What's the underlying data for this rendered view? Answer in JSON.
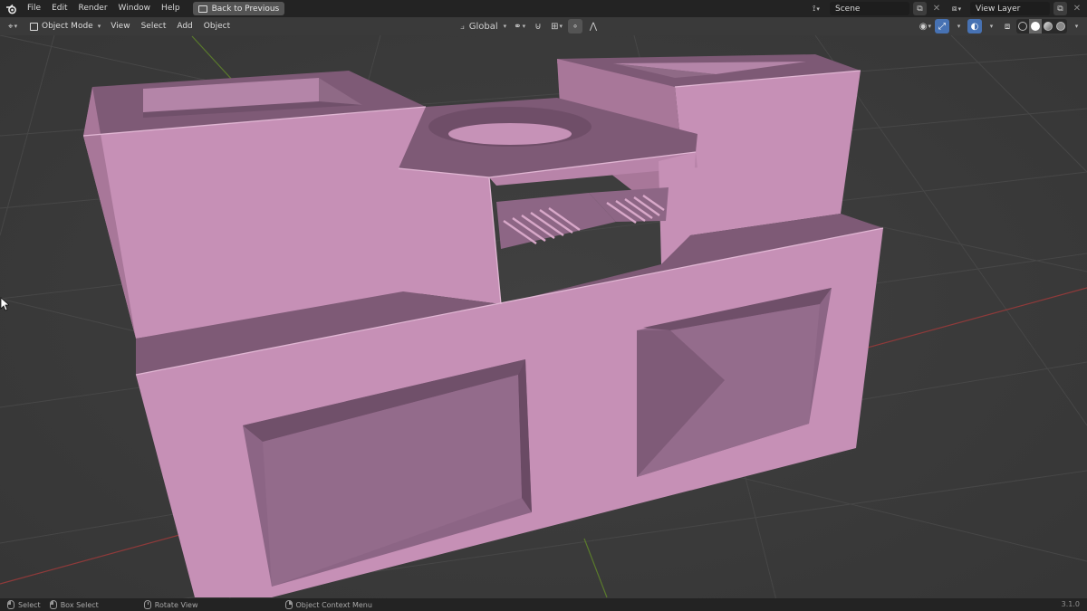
{
  "app": {
    "menu": [
      "File",
      "Edit",
      "Render",
      "Window",
      "Help"
    ],
    "back_button": "Back to Previous",
    "scene_name": "Scene",
    "view_layer": "View Layer"
  },
  "viewport_header": {
    "mode": "Object Mode",
    "menus": [
      "View",
      "Select",
      "Add",
      "Object"
    ],
    "transform_orientation": "Global"
  },
  "statusbar": {
    "select": "Select",
    "box_select": "Box Select",
    "rotate_view": "Rotate View",
    "context_menu": "Object Context Menu",
    "version": "3.1.0"
  },
  "icons": {
    "logo": "blender-logo-icon",
    "editor_type": "view3d-editor-icon",
    "snap": "magnet-icon",
    "proportional": "proportional-editing-icon",
    "visibility": "eye-icon",
    "gizmo": "gizmo-icon",
    "overlay": "overlay-icon",
    "xray": "xray-icon"
  },
  "colors": {
    "accent": "#4772b3",
    "model": "#c98fb6",
    "x_axis": "#9b3b3b",
    "y_axis": "#5f8a2e"
  }
}
